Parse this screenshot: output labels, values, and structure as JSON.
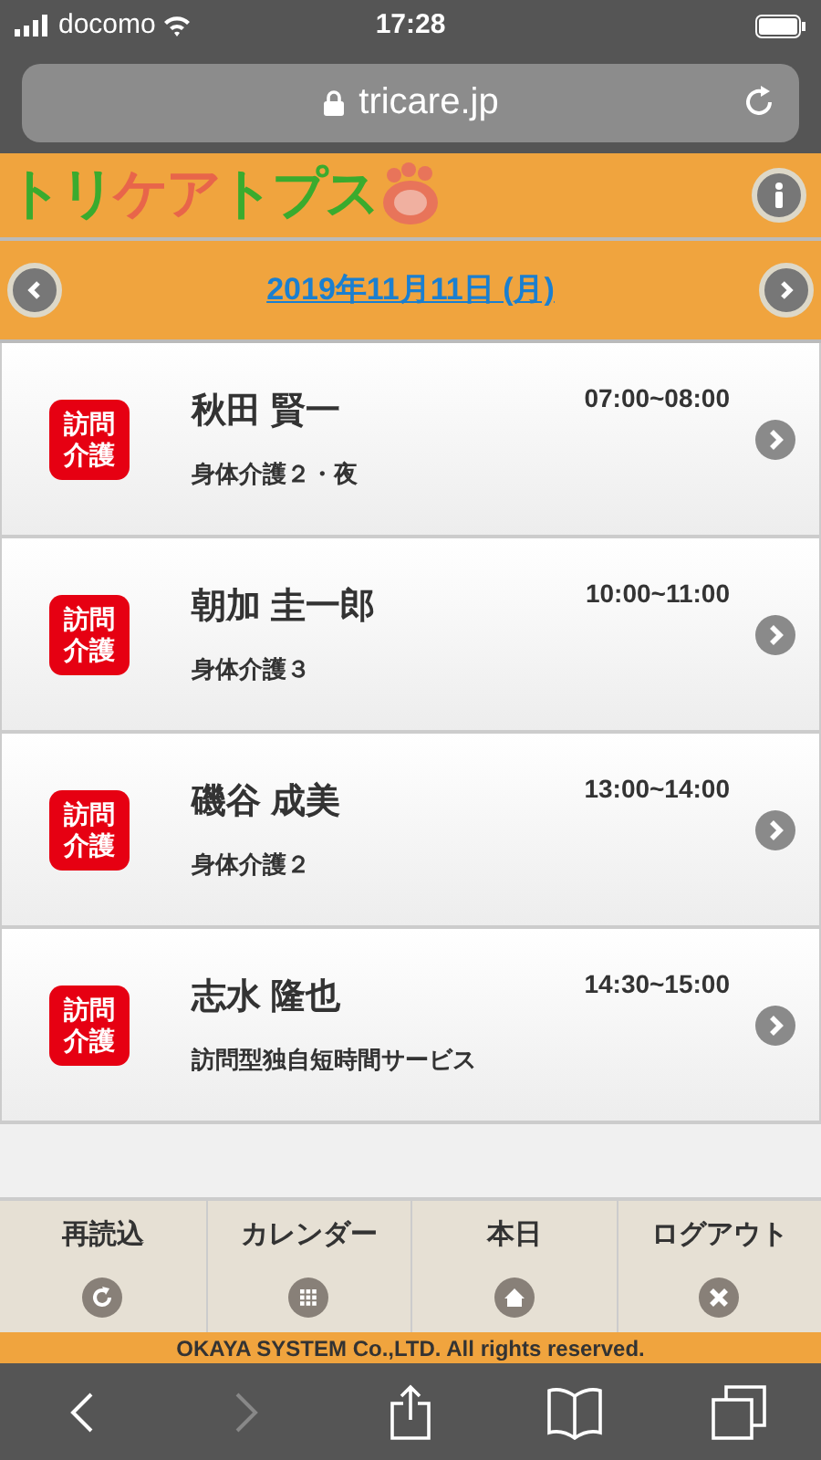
{
  "status_bar": {
    "carrier": "docomo",
    "time": "17:28"
  },
  "address_bar": {
    "url": "tricare.jp"
  },
  "header": {
    "logo": "トリケアトプス"
  },
  "date_bar": {
    "date": "2019年11月11日 (月)"
  },
  "visits": [
    {
      "badge": "訪問介護",
      "name": "秋田 賢一",
      "service": "身体介護２・夜",
      "time": "07:00~08:00"
    },
    {
      "badge": "訪問介護",
      "name": "朝加 圭一郎",
      "service": "身体介護３",
      "time": "10:00~11:00"
    },
    {
      "badge": "訪問介護",
      "name": "磯谷 成美",
      "service": "身体介護２",
      "time": "13:00~14:00"
    },
    {
      "badge": "訪問介護",
      "name": "志水 隆也",
      "service": "訪問型独自短時間サービス",
      "time": "14:30~15:00"
    }
  ],
  "tabs": [
    {
      "label": "再読込",
      "kind": "reload"
    },
    {
      "label": "カレンダー",
      "kind": "calendar"
    },
    {
      "label": "本日",
      "kind": "home"
    },
    {
      "label": "ログアウト",
      "kind": "logout"
    }
  ],
  "copyright": "OKAYA SYSTEM Co.,LTD. All rights reserved.",
  "browser_toolbar": {
    "back_disabled": false,
    "forward_disabled": true
  }
}
